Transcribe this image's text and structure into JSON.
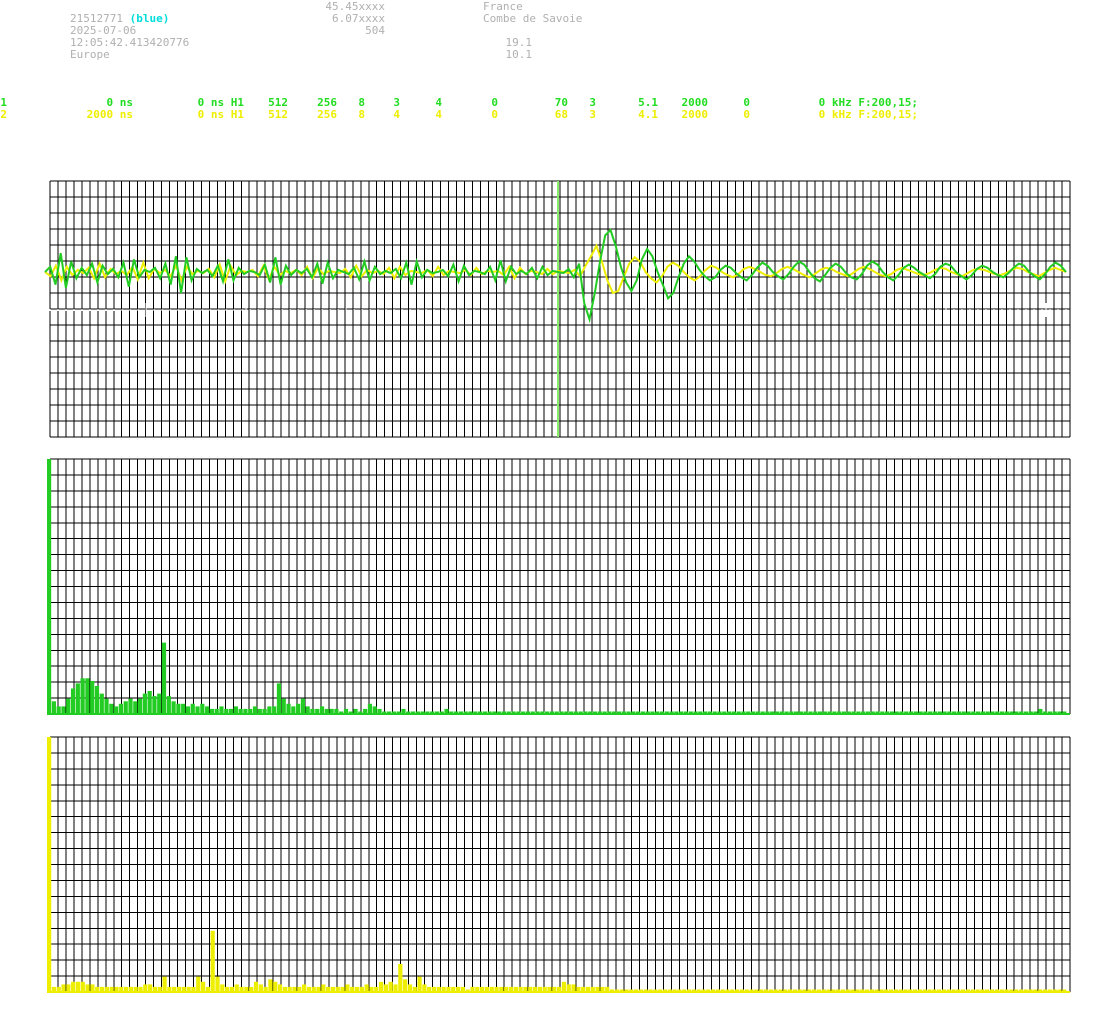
{
  "header": {
    "station_id": "2771",
    "station_tag": "(blue)",
    "line2": "2151",
    "date": "2025-07-06",
    "time": "12:05:42.413420776",
    "region": "Europe",
    "lat": "45.45xxxx",
    "lon": "6.07xxxx",
    "alt": "504",
    "country": "France",
    "place": "Combe de Savoie",
    "val1": "19.1",
    "val2": "10.1"
  },
  "channels": [
    {
      "fields": [
        "1",
        "0 ns",
        "0 ns H1",
        "512",
        "256",
        "8",
        "3",
        "4",
        "0",
        "70",
        "3",
        "5.1",
        "2000",
        "0",
        "0 kHz F:200,15;"
      ],
      "color": "#22dd22"
    },
    {
      "fields": [
        "2",
        "2000 ns",
        "0 ns H1",
        "512",
        "256",
        "8",
        "4",
        "4",
        "0",
        "68",
        "3",
        "4.1",
        "2000",
        "0",
        "0 kHz F:200,15;"
      ],
      "color": "#eeee00"
    }
  ],
  "colors": {
    "tag": "#00dddd",
    "grid": "#000000",
    "ch1": "#22cc22",
    "ch2": "#eeee00",
    "marker": "#88ee66",
    "baseline_ticks": "#ffffff"
  },
  "chart_data": [
    {
      "type": "line",
      "series": [
        {
          "values": [
            0,
            5,
            -12,
            18,
            -15,
            10,
            -6,
            4,
            -3,
            8,
            -10,
            6,
            -2,
            3,
            -5,
            9,
            -14,
            12,
            -5,
            2,
            0,
            4,
            -6,
            8,
            -12,
            15,
            -20,
            14,
            -8,
            3,
            -1,
            2,
            -4,
            6,
            -9,
            12,
            -8,
            4,
            -2,
            1,
            0,
            -3,
            7,
            -10,
            14,
            -12,
            6,
            -3,
            2,
            -1,
            3,
            -5,
            8,
            -11,
            9,
            -6,
            2,
            0,
            -2,
            4,
            -7,
            10,
            -8,
            5,
            -2,
            1,
            -1,
            3,
            -6,
            9,
            -12,
            10,
            -5,
            2,
            -1,
            0,
            2,
            -4,
            7,
            -9,
            6,
            -3,
            1,
            0,
            -2,
            5,
            -8,
            11,
            -9,
            5,
            -2,
            1,
            -2,
            4,
            -6,
            5,
            -3,
            1,
            0,
            -1,
            3,
            -5,
            8,
            -30,
            -45,
            -20,
            10,
            35,
            40,
            25,
            5,
            -10,
            -18,
            -8,
            12,
            22,
            15,
            0,
            -12,
            -25,
            -20,
            -5,
            8,
            15,
            10,
            2,
            -4,
            -8,
            -5,
            2,
            6,
            4,
            -1,
            -5,
            -8,
            -3,
            4,
            9,
            6,
            0,
            -4,
            -7,
            -2,
            5,
            10,
            7,
            0,
            -6,
            -9,
            -3,
            4,
            8,
            5,
            -1,
            -5,
            -7,
            -2,
            6,
            10,
            7,
            0,
            -5,
            -8,
            -3,
            4,
            7,
            4,
            0,
            -3,
            -6,
            -2,
            5,
            8,
            6,
            0,
            -4,
            -7,
            -3,
            3,
            6,
            4,
            0,
            -3,
            -5,
            -1,
            4,
            8,
            6,
            0,
            -4,
            -7,
            -2,
            5,
            9,
            6,
            0
          ]
        },
        {
          "values": [
            0,
            -4,
            6,
            -8,
            5,
            -3,
            2,
            -1,
            4,
            -6,
            8,
            -5,
            3,
            -2,
            1,
            -3,
            5,
            -7,
            9,
            -6,
            3,
            -1,
            2,
            -4,
            6,
            -8,
            5,
            -2,
            1,
            -1,
            3,
            -5,
            7,
            -9,
            6,
            -3,
            1,
            0,
            2,
            -4,
            6,
            -7,
            5,
            -3,
            1,
            -1,
            2,
            -3,
            5,
            -6,
            4,
            -2,
            1,
            0,
            -1,
            3,
            -5,
            6,
            -4,
            2,
            -1,
            1,
            -2,
            4,
            -6,
            5,
            -3,
            1,
            0,
            -1,
            2,
            -4,
            5,
            -3,
            1,
            0,
            -1,
            2,
            -3,
            4,
            -2,
            1,
            0,
            1,
            -3,
            5,
            -6,
            4,
            -2,
            1,
            0,
            -2,
            3,
            -2,
            1,
            0,
            -1,
            2,
            -4,
            6,
            15,
            25,
            10,
            -8,
            -20,
            -18,
            -5,
            8,
            14,
            10,
            0,
            -6,
            -10,
            -4,
            5,
            9,
            6,
            0,
            -5,
            -8,
            -4,
            2,
            6,
            4,
            0,
            -3,
            -5,
            -2,
            3,
            5,
            3,
            0,
            -3,
            -4,
            -1,
            3,
            5,
            3,
            0,
            -3,
            -5,
            -2,
            2,
            4,
            3,
            0,
            -2,
            -4,
            -1,
            3,
            5,
            3,
            0,
            -3,
            -4,
            -2,
            2,
            4,
            2,
            0,
            -2,
            -3,
            -1,
            2,
            4,
            3,
            0,
            -2,
            -4,
            -1,
            2,
            3,
            2,
            0,
            -2,
            -3,
            -1,
            2,
            4,
            3,
            0,
            -2,
            -4,
            -1,
            2,
            4,
            2,
            0
          ]
        }
      ]
    },
    {
      "type": "bar",
      "values": [
        100,
        5,
        3,
        3,
        6,
        10,
        12,
        14,
        14,
        13,
        11,
        8,
        6,
        4,
        3,
        4,
        5,
        6,
        5,
        6,
        8,
        9,
        7,
        8,
        28,
        7,
        5,
        4,
        4,
        3,
        4,
        3,
        4,
        3,
        2,
        2,
        3,
        2,
        2,
        3,
        2,
        2,
        2,
        3,
        2,
        2,
        3,
        3,
        12,
        6,
        4,
        3,
        4,
        6,
        3,
        2,
        2,
        3,
        2,
        2,
        2,
        1,
        2,
        1,
        2,
        1,
        2,
        4,
        3,
        2,
        1,
        1,
        1,
        1,
        2,
        1,
        1,
        1,
        1,
        1,
        1,
        1,
        1,
        2,
        1,
        1,
        1,
        1,
        1,
        1,
        1,
        1,
        1,
        1,
        1,
        1,
        1,
        1,
        1,
        1,
        1,
        1,
        1,
        1,
        1,
        1,
        1,
        1,
        1,
        1,
        1,
        1,
        1,
        1,
        1,
        1,
        1,
        1,
        1,
        1,
        1,
        1,
        1,
        1,
        1,
        1,
        1,
        1,
        1,
        1,
        1,
        1,
        1,
        1,
        1,
        1,
        1,
        1,
        1,
        1,
        1,
        1,
        1,
        1,
        1,
        1,
        1,
        1,
        1,
        1,
        1,
        1,
        1,
        1,
        1,
        1,
        1,
        1,
        1,
        1,
        1,
        1,
        1,
        1,
        1,
        1,
        1,
        1,
        1,
        1,
        1,
        1,
        1,
        1,
        1,
        1,
        1,
        1,
        1,
        1,
        1,
        1,
        1,
        1,
        1,
        1,
        1,
        1,
        1,
        1,
        1,
        1,
        1,
        1,
        1,
        1,
        1,
        1,
        1,
        1,
        1,
        1,
        1,
        1,
        1,
        1,
        1,
        2,
        1,
        1,
        1,
        1,
        1
      ],
      "ylim": [
        0,
        100
      ]
    },
    {
      "type": "bar",
      "values": [
        100,
        2,
        2,
        3,
        3,
        4,
        4,
        4,
        3,
        3,
        2,
        2,
        2,
        2,
        2,
        2,
        2,
        2,
        2,
        2,
        3,
        3,
        2,
        2,
        6,
        2,
        2,
        2,
        2,
        2,
        2,
        6,
        4,
        2,
        24,
        6,
        3,
        2,
        2,
        3,
        2,
        2,
        2,
        4,
        3,
        2,
        5,
        4,
        3,
        2,
        2,
        2,
        2,
        3,
        2,
        2,
        2,
        3,
        2,
        2,
        2,
        2,
        3,
        2,
        2,
        2,
        3,
        2,
        2,
        4,
        3,
        4,
        3,
        11,
        5,
        3,
        2,
        6,
        3,
        2,
        2,
        2,
        2,
        2,
        2,
        2,
        2,
        1,
        2,
        2,
        2,
        2,
        2,
        2,
        2,
        2,
        2,
        2,
        2,
        2,
        2,
        2,
        2,
        2,
        2,
        2,
        2,
        4,
        3,
        3,
        2,
        2,
        2,
        2,
        2,
        2,
        2,
        1,
        1,
        1,
        1,
        1,
        1,
        1,
        1,
        1,
        1,
        1,
        1,
        1,
        1,
        1,
        1,
        1,
        1,
        1,
        1,
        1,
        1,
        1,
        1,
        1,
        1,
        1,
        1,
        1,
        1,
        1,
        1,
        1,
        1,
        1,
        1,
        1,
        1,
        1,
        1,
        1,
        1,
        1,
        1,
        1,
        1,
        1,
        1,
        1,
        1,
        1,
        1,
        1,
        1,
        1,
        1,
        1,
        1,
        1,
        1,
        1,
        1,
        1,
        1,
        1,
        1,
        1,
        1,
        1,
        1,
        1,
        1,
        1,
        1,
        1,
        1,
        1,
        1,
        1,
        1,
        1,
        1,
        1,
        1,
        1,
        1,
        1,
        1,
        1,
        1,
        1,
        1,
        1,
        1,
        1
      ],
      "ylim": [
        0,
        100
      ]
    }
  ]
}
